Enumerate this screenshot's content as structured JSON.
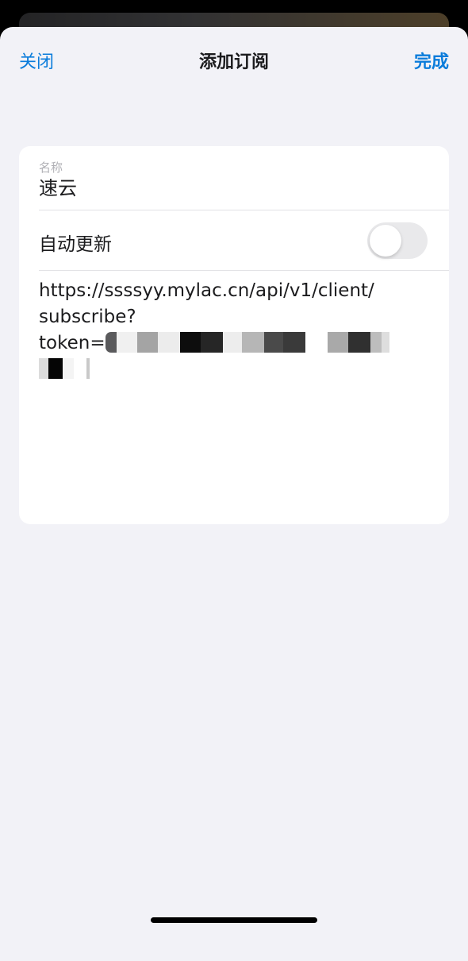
{
  "nav": {
    "close_label": "关闭",
    "title": "添加订阅",
    "done_label": "完成"
  },
  "form": {
    "name_label": "名称",
    "name_value": "速云",
    "auto_update_label": "自动更新",
    "auto_update_enabled": false,
    "url_line1": "https://ssssyy.mylac.cn/api/v1/client/",
    "url_line2": "subscribe?",
    "url_line3_prefix": "token="
  },
  "colors": {
    "accent": "#0a7cdb",
    "sheet_bg": "#f2f2f7",
    "card_bg": "#ffffff",
    "toggle_off": "#e9e9eb"
  }
}
